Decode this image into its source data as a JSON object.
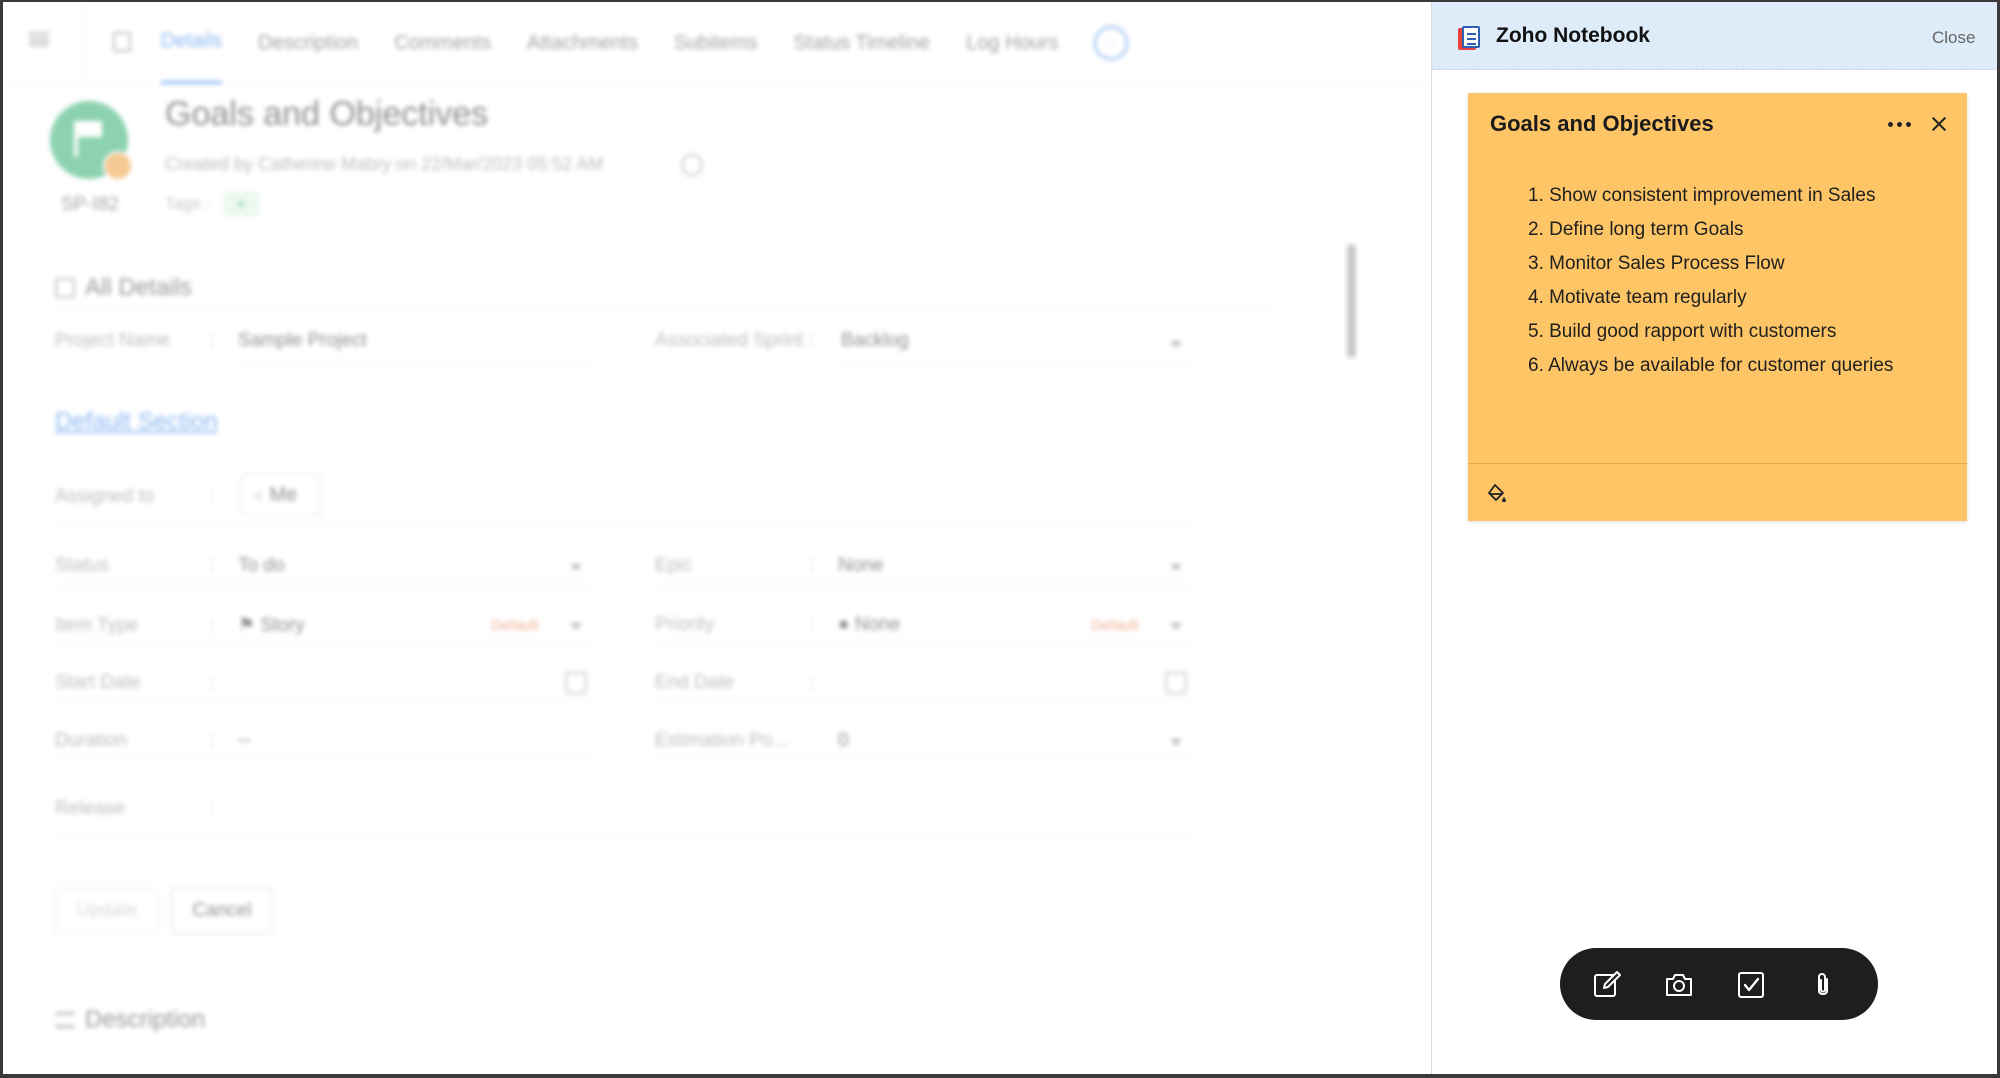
{
  "background": {
    "tabs": [
      "Details",
      "Description",
      "Comments",
      "Attachments",
      "Subitems",
      "Status Timeline",
      "Log Hours"
    ],
    "more_tab": "···",
    "item_id": "SP-I82",
    "item_title": "Goals and Objectives",
    "created_text": "Created by Catherine Mabry on 22/Mar/2023 05:52 AM",
    "tags_label": "Tags :",
    "tag_add": "+",
    "all_details": "All Details",
    "default_section": "Default Section",
    "description_heading": "Description",
    "fields": {
      "project_name": {
        "label": "Project Name",
        "value": "Sample Project"
      },
      "associated_sprint": {
        "label": "Associated Sprint :",
        "value": "Backlog"
      },
      "assigned_to": {
        "label": "Assigned to",
        "value": "Me"
      },
      "status": {
        "label": "Status",
        "value": "To do"
      },
      "epic": {
        "label": "Epic",
        "value": "None"
      },
      "item_type": {
        "label": "Item Type",
        "value": "Story",
        "tag": "Default"
      },
      "priority": {
        "label": "Priority",
        "value": "None",
        "tag": "Default"
      },
      "start_date": {
        "label": "Start Date",
        "value": ""
      },
      "end_date": {
        "label": "End Date",
        "value": ""
      },
      "duration": {
        "label": "Duration",
        "value": "--"
      },
      "estimation_points": {
        "label": "Estimation Po...",
        "value": "0"
      },
      "release": {
        "label": "Release",
        "value": ""
      }
    },
    "colon": ":",
    "update_button": "Update",
    "cancel_button": "Cancel"
  },
  "panel": {
    "title": "Zoho Notebook",
    "close_label": "Close",
    "note": {
      "title": "Goals and Objectives",
      "color": "#fdc565",
      "items": [
        "1. Show consistent improvement in Sales",
        "2. Define long term Goals",
        "3. Monitor Sales Process Flow",
        "4. Motivate team regularly",
        "5. Build good rapport with customers",
        "6. Always be available for customer queries"
      ]
    },
    "dock_icons": [
      "edit-icon",
      "camera-icon",
      "checkbox-icon",
      "paperclip-icon"
    ]
  }
}
